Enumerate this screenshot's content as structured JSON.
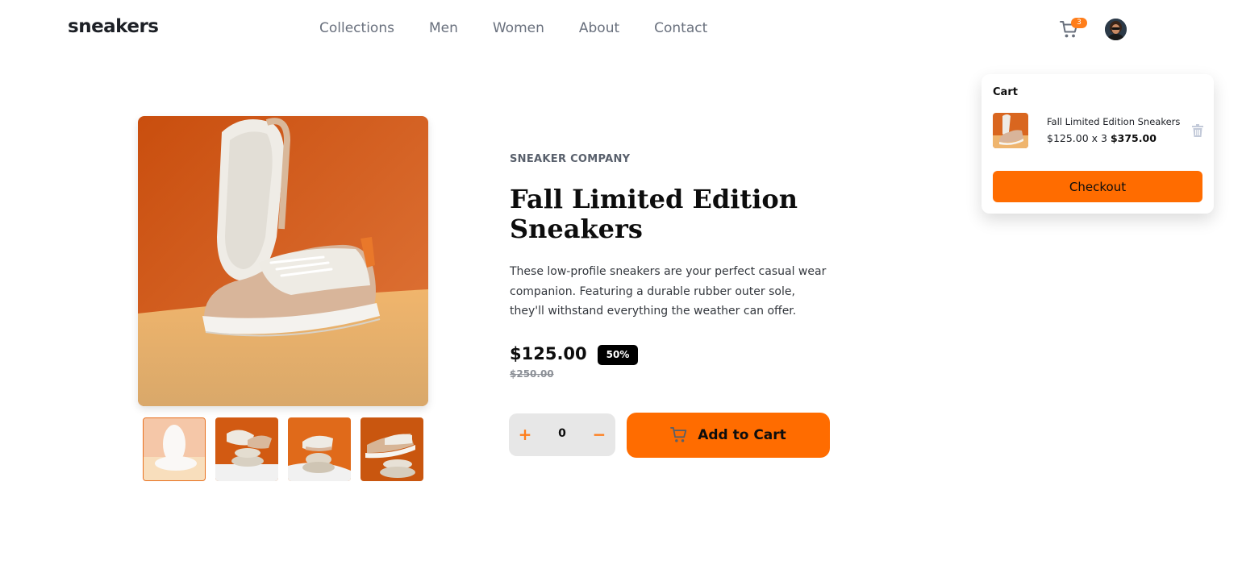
{
  "header": {
    "logo": "sneakers",
    "nav": [
      "Collections",
      "Men",
      "Women",
      "About",
      "Contact"
    ],
    "cart_count": "3"
  },
  "product": {
    "company": "SNEAKER COMPANY",
    "title": "Fall Limited Edition Sneakers",
    "description": "These low-profile sneakers are your perfect casual wear companion. Featuring a durable rubber outer sole, they'll withstand everything the weather can offer.",
    "price": "$125.00",
    "discount": "50%",
    "old_price": "$250.00",
    "quantity": "0",
    "qty_plus": "+",
    "qty_minus": "−",
    "add_to_cart": "Add to Cart",
    "thumbnail_count": 4
  },
  "cart": {
    "heading": "Cart",
    "item_name": "Fall Limited Edition Sneakers",
    "item_unit": "$125.00 x 3",
    "item_total": "$375.00",
    "checkout": "Checkout"
  },
  "colors": {
    "accent": "#ff6c00",
    "text_dark": "#0d0d0d",
    "text_muted": "#69707d"
  },
  "icons": [
    "cart-icon",
    "trash-icon",
    "avatar"
  ]
}
